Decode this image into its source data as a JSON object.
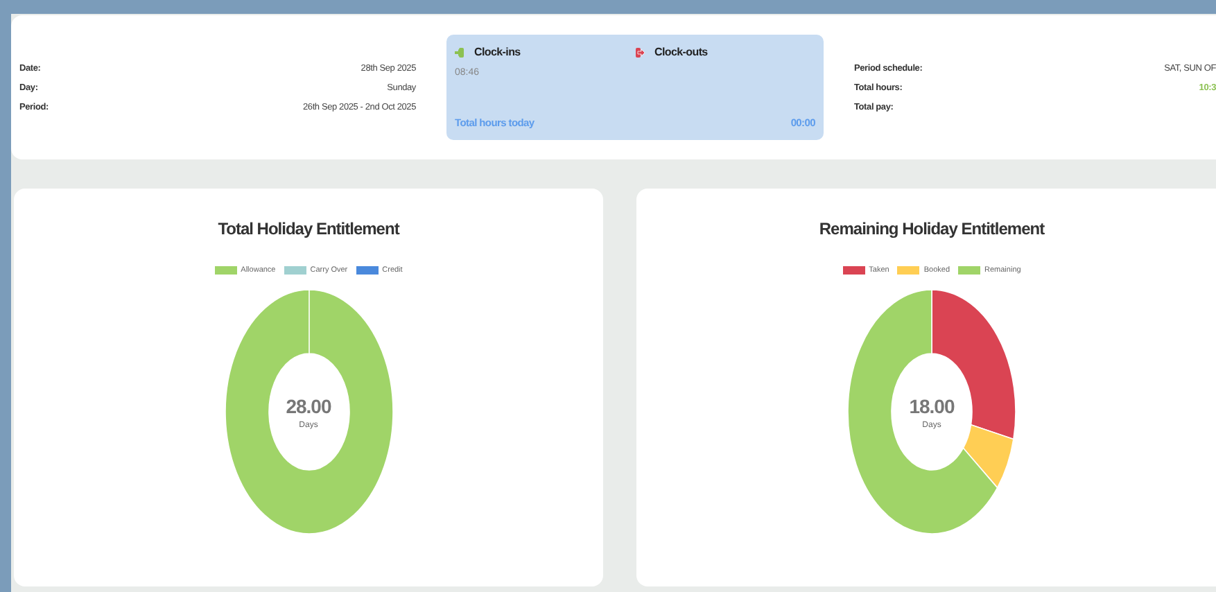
{
  "summary": {
    "rows": [
      {
        "label": "Date:",
        "value": "28th Sep 2025"
      },
      {
        "label": "Day:",
        "value": "Sunday"
      },
      {
        "label": "Period:",
        "value": "26th Sep 2025 - 2nd Oct 2025"
      }
    ]
  },
  "clock": {
    "clock_ins": {
      "label": "Clock-ins",
      "times": [
        "08:46"
      ]
    },
    "clock_outs": {
      "label": "Clock-outs"
    },
    "total_label": "Total hours today",
    "total_value": "00:00"
  },
  "period": {
    "rows": [
      {
        "label": "Period schedule:",
        "value": "SAT, SUN OF",
        "kind": "text"
      },
      {
        "label": "Total hours:",
        "value": "10:3",
        "kind": "hours"
      },
      {
        "label": "Total pay:"
      }
    ]
  },
  "charts": [
    {
      "title": "Total Holiday Entitlement",
      "center_value": "28.00",
      "center_unit": "Days",
      "segments": [
        {
          "name": "Allowance",
          "color": "#a0d468"
        },
        {
          "name": "Carry Over",
          "color": "#a0d0d0"
        },
        {
          "name": "Credit",
          "color": "#4a89dc"
        }
      ]
    },
    {
      "title": "Remaining Holiday Entitlement",
      "center_value": "18.00",
      "center_unit": "Days",
      "segments": [
        {
          "name": "Taken",
          "color": "#da4453"
        },
        {
          "name": "Booked",
          "color": "#ffce54"
        },
        {
          "name": "Remaining",
          "color": "#a0d468"
        }
      ]
    }
  ]
}
